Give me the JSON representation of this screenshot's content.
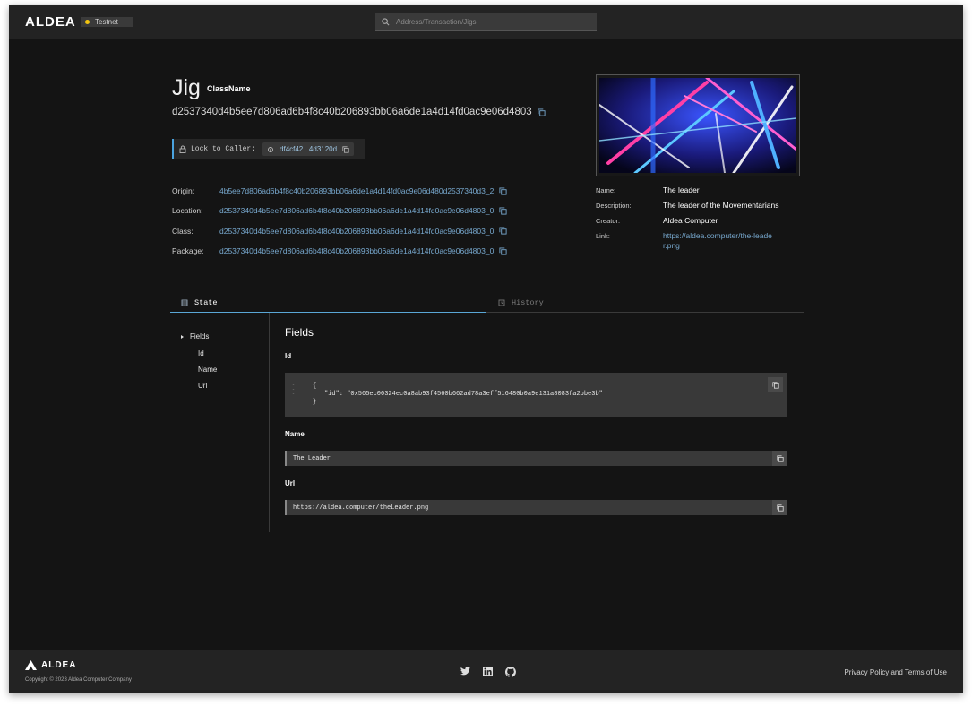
{
  "header": {
    "logo": "ALDEA",
    "network": "Testnet",
    "network_color": "#f2c40f",
    "search_placeholder": "Address/Transaction/Jigs"
  },
  "jig": {
    "title": "Jig",
    "class_name": "ClassName",
    "id": "d2537340d4b5ee7d806ad6b4f8c40b206893bb06a6de1a4d14fd0ac9e06d4803",
    "lock_label": "Lock to Caller:",
    "caller": "df4cf42...4d3120d",
    "props": [
      {
        "key": "Origin:",
        "value": "4b5ee7d806ad6b4f8c40b206893bb06a6de1a4d14fd0ac9e06d480d2537340d3_2"
      },
      {
        "key": "Location:",
        "value": "d2537340d4b5ee7d806ad6b4f8c40b206893bb06a6de1a4d14fd0ac9e06d4803_0"
      },
      {
        "key": "Class:",
        "value": "d2537340d4b5ee7d806ad6b4f8c40b206893bb06a6de1a4d14fd0ac9e06d4803_0"
      },
      {
        "key": "Package:",
        "value": "d2537340d4b5ee7d806ad6b4f8c40b206893bb06a6de1a4d14fd0ac9e06d4803_0"
      }
    ]
  },
  "meta": {
    "name_key": "Name:",
    "name": "The leader",
    "description_key": "Description:",
    "description": "The leader of the Movementarians",
    "creator_key": "Creator:",
    "creator": "Aldea Computer",
    "link_key": "Link:",
    "link": "https://aldea.computer/the-leader.png"
  },
  "tabs": {
    "state": "State",
    "history": "History"
  },
  "tree": {
    "root": "Fields",
    "items": [
      "Id",
      "Name",
      "Url"
    ]
  },
  "fields": {
    "title": "Fields",
    "id_label": "Id",
    "id_json_open": "{",
    "id_json_line": "\"id\": \"0x565ec00324ec0a8ab93f4560b662ad78a3eff516480b0a9e131a8083fa2bbe3b\"",
    "id_json_close": "}",
    "name_label": "Name",
    "name_value": "The Leader",
    "url_label": "Url",
    "url_value": "https://aldea.computer/theLeader.png"
  },
  "footer": {
    "logo": "ALDEA",
    "copyright": "Copyright © 2023 Aldea Computer Company",
    "legal": "Privacy Policy and Terms of Use",
    "socials": [
      "twitter-icon",
      "linkedin-icon",
      "github-icon"
    ]
  },
  "colors": {
    "accent": "#5aa7d6",
    "link": "#78a9cf",
    "background": "#141414",
    "bar": "#232323"
  }
}
